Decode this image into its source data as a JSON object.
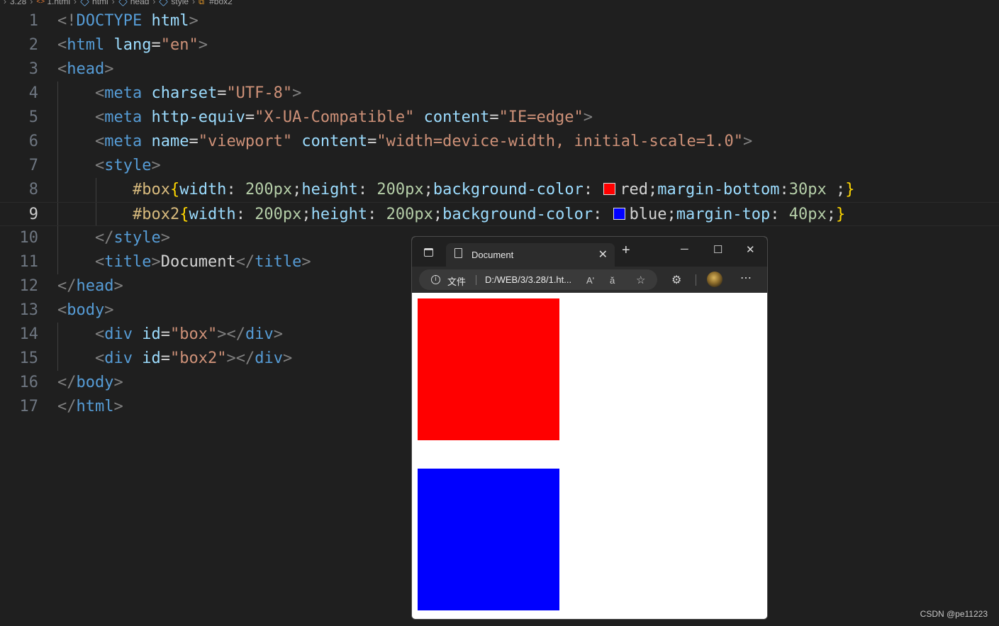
{
  "breadcrumb": [
    "3.28",
    "1.html",
    "html",
    "head",
    "style",
    "#box2"
  ],
  "editor": {
    "line_numbers": [
      "1",
      "2",
      "3",
      "4",
      "5",
      "6",
      "7",
      "8",
      "9",
      "10",
      "11",
      "12",
      "13",
      "14",
      "15",
      "16",
      "17"
    ],
    "current_line": "9",
    "lines": [
      [
        [
          "p",
          "<!"
        ],
        [
          "t",
          "DOCTYPE"
        ],
        [
          "d",
          " "
        ],
        [
          "a",
          "html"
        ],
        [
          "p",
          ">"
        ]
      ],
      [
        [
          "p",
          "<"
        ],
        [
          "t",
          "html"
        ],
        [
          "d",
          " "
        ],
        [
          "a",
          "lang"
        ],
        [
          "d",
          "="
        ],
        [
          "s",
          "\"en\""
        ],
        [
          "p",
          ">"
        ]
      ],
      [
        [
          "p",
          "<"
        ],
        [
          "t",
          "head"
        ],
        [
          "p",
          ">"
        ]
      ],
      [
        [
          "d",
          "    "
        ],
        [
          "p",
          "<"
        ],
        [
          "t",
          "meta"
        ],
        [
          "d",
          " "
        ],
        [
          "a",
          "charset"
        ],
        [
          "d",
          "="
        ],
        [
          "s",
          "\"UTF-8\""
        ],
        [
          "p",
          ">"
        ]
      ],
      [
        [
          "d",
          "    "
        ],
        [
          "p",
          "<"
        ],
        [
          "t",
          "meta"
        ],
        [
          "d",
          " "
        ],
        [
          "a",
          "http-equiv"
        ],
        [
          "d",
          "="
        ],
        [
          "s",
          "\"X-UA-Compatible\""
        ],
        [
          "d",
          " "
        ],
        [
          "a",
          "content"
        ],
        [
          "d",
          "="
        ],
        [
          "s",
          "\"IE=edge\""
        ],
        [
          "p",
          ">"
        ]
      ],
      [
        [
          "d",
          "    "
        ],
        [
          "p",
          "<"
        ],
        [
          "t",
          "meta"
        ],
        [
          "d",
          " "
        ],
        [
          "a",
          "name"
        ],
        [
          "d",
          "="
        ],
        [
          "s",
          "\"viewport\""
        ],
        [
          "d",
          " "
        ],
        [
          "a",
          "content"
        ],
        [
          "d",
          "="
        ],
        [
          "s",
          "\"width=device-width, initial-scale=1.0\""
        ],
        [
          "p",
          ">"
        ]
      ],
      [
        [
          "d",
          "    "
        ],
        [
          "p",
          "<"
        ],
        [
          "t",
          "style"
        ],
        [
          "p",
          ">"
        ]
      ],
      [
        [
          "d",
          "        "
        ],
        [
          "sel",
          "#box"
        ],
        [
          "br",
          "{"
        ],
        [
          "a",
          "width"
        ],
        [
          "d",
          ": "
        ],
        [
          "n",
          "200px"
        ],
        [
          "d",
          ";"
        ],
        [
          "a",
          "height"
        ],
        [
          "d",
          ": "
        ],
        [
          "n",
          "200px"
        ],
        [
          "d",
          ";"
        ],
        [
          "a",
          "background-color"
        ],
        [
          "d",
          ": "
        ],
        [
          "swatch",
          "#ff0000"
        ],
        [
          "d",
          "red;"
        ],
        [
          "a",
          "margin-bottom"
        ],
        [
          "d",
          ":"
        ],
        [
          "n",
          "30px"
        ],
        [
          "d",
          " ;"
        ],
        [
          "br",
          "}"
        ]
      ],
      [
        [
          "d",
          "        "
        ],
        [
          "sel",
          "#box2"
        ],
        [
          "br",
          "{"
        ],
        [
          "a",
          "width"
        ],
        [
          "d",
          ": "
        ],
        [
          "n",
          "200px"
        ],
        [
          "d",
          ";"
        ],
        [
          "a",
          "height"
        ],
        [
          "d",
          ": "
        ],
        [
          "n",
          "200px"
        ],
        [
          "d",
          ";"
        ],
        [
          "a",
          "background-color"
        ],
        [
          "d",
          ": "
        ],
        [
          "swatch",
          "#0000ff"
        ],
        [
          "d",
          "blue;"
        ],
        [
          "a",
          "margin-top"
        ],
        [
          "d",
          ": "
        ],
        [
          "n",
          "40px"
        ],
        [
          "d",
          ";"
        ],
        [
          "br",
          "}"
        ]
      ],
      [
        [
          "d",
          "    "
        ],
        [
          "p",
          "</"
        ],
        [
          "t",
          "style"
        ],
        [
          "p",
          ">"
        ]
      ],
      [
        [
          "d",
          "    "
        ],
        [
          "p",
          "<"
        ],
        [
          "t",
          "title"
        ],
        [
          "p",
          ">"
        ],
        [
          "d",
          "Document"
        ],
        [
          "p",
          "</"
        ],
        [
          "t",
          "title"
        ],
        [
          "p",
          ">"
        ]
      ],
      [
        [
          "p",
          "</"
        ],
        [
          "t",
          "head"
        ],
        [
          "p",
          ">"
        ]
      ],
      [
        [
          "p",
          "<"
        ],
        [
          "t",
          "body"
        ],
        [
          "p",
          ">"
        ]
      ],
      [
        [
          "d",
          "    "
        ],
        [
          "p",
          "<"
        ],
        [
          "t",
          "div"
        ],
        [
          "d",
          " "
        ],
        [
          "a",
          "id"
        ],
        [
          "d",
          "="
        ],
        [
          "s",
          "\"box\""
        ],
        [
          "p",
          "></"
        ],
        [
          "t",
          "div"
        ],
        [
          "p",
          ">"
        ]
      ],
      [
        [
          "d",
          "    "
        ],
        [
          "p",
          "<"
        ],
        [
          "t",
          "div"
        ],
        [
          "d",
          " "
        ],
        [
          "a",
          "id"
        ],
        [
          "d",
          "="
        ],
        [
          "s",
          "\"box2\""
        ],
        [
          "p",
          "></"
        ],
        [
          "t",
          "div"
        ],
        [
          "p",
          ">"
        ]
      ],
      [
        [
          "p",
          "</"
        ],
        [
          "t",
          "body"
        ],
        [
          "p",
          ">"
        ]
      ],
      [
        [
          "p",
          "</"
        ],
        [
          "t",
          "html"
        ],
        [
          "p",
          ">"
        ]
      ]
    ]
  },
  "browser": {
    "tab_title": "Document",
    "site_label": "文件",
    "url": "D:/WEB/3/3.28/1.ht...",
    "read_aloud": "Aʹ",
    "translate": "ă",
    "boxes": [
      {
        "name": "box",
        "color": "#ff0000"
      },
      {
        "name": "box2",
        "color": "#0000ff"
      }
    ]
  },
  "watermark": "CSDN @pe11223"
}
